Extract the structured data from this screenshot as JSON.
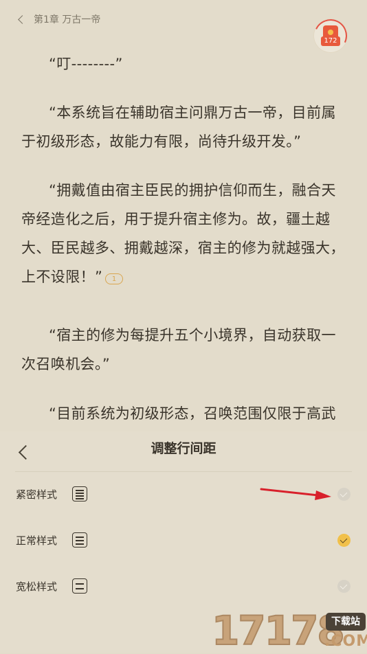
{
  "reader": {
    "chapter_title": "第1章 万古一帝",
    "red_packet_count": "172",
    "paragraphs": [
      "“叮--------”",
      "“本系统旨在辅助宿主问鼎万古一帝，目前属于初级形态，故能力有限，尚待升级开发。”",
      "“拥戴值由宿主臣民的拥护信仰而生，融合天帝经造化之后，用于提升宿主修为。故，疆土越大、臣民越多、拥戴越深，宿主的修为就越强大，上不设限！”",
      "“宿主的修为每提升五个小境界，自动获取一次召唤机会。”",
      "“目前系统为初级形态，召唤范围仅限于高武人"
    ],
    "comment_count": "1"
  },
  "panel": {
    "title": "调整行间距",
    "options": [
      {
        "label": "紧密样式",
        "selected": false
      },
      {
        "label": "正常样式",
        "selected": true
      },
      {
        "label": "宽松样式",
        "selected": false
      }
    ]
  },
  "watermark": {
    "digits": "17178",
    "box_text": "下载站",
    "domain": ".COM"
  },
  "colors": {
    "background": "#e3dccb",
    "accent": "#f1c04a",
    "red_packet": "#e85a3c",
    "annotation_arrow": "#d8202b"
  }
}
